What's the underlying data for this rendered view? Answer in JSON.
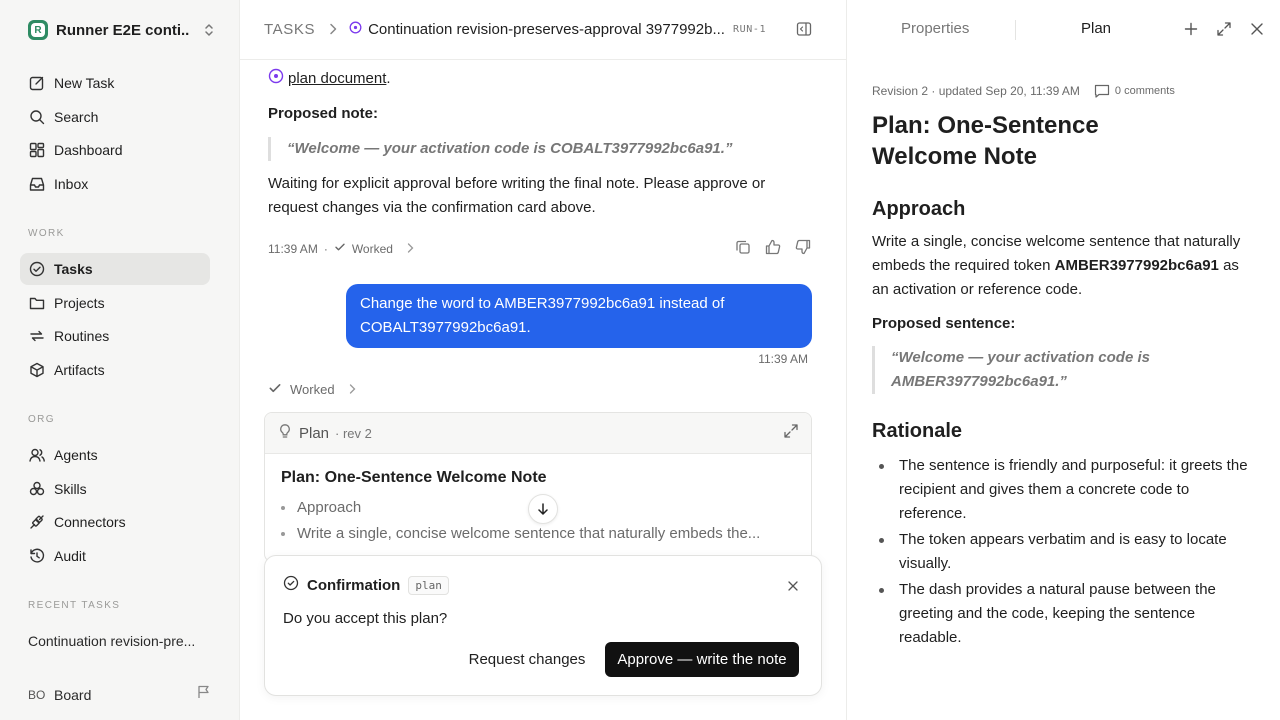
{
  "workspace": {
    "name": "Runner E2E conti...",
    "logo_letter": "R"
  },
  "sidebar": {
    "nav": [
      {
        "label": "New Task",
        "icon": "new-task-icon"
      },
      {
        "label": "Search",
        "icon": "search-icon"
      },
      {
        "label": "Dashboard",
        "icon": "dashboard-icon"
      },
      {
        "label": "Inbox",
        "icon": "inbox-icon"
      }
    ],
    "work_label": "WORK",
    "work": [
      {
        "label": "Tasks",
        "icon": "tasks-icon",
        "active": true
      },
      {
        "label": "Projects",
        "icon": "folder-icon"
      },
      {
        "label": "Routines",
        "icon": "routines-icon"
      },
      {
        "label": "Artifacts",
        "icon": "artifacts-icon"
      }
    ],
    "org_label": "ORG",
    "org": [
      {
        "label": "Agents",
        "icon": "agents-icon"
      },
      {
        "label": "Skills",
        "icon": "skills-icon"
      },
      {
        "label": "Connectors",
        "icon": "connectors-icon"
      },
      {
        "label": "Audit",
        "icon": "audit-icon"
      }
    ],
    "recent_label": "RECENT TASKS",
    "recent": [
      "Continuation revision-pre..."
    ],
    "user": {
      "initials": "BO",
      "name": "Board"
    }
  },
  "topbar": {
    "root": "TASKS",
    "title": "Continuation revision-preserves-approval 3977992b...",
    "run": "RUN-1"
  },
  "thread": {
    "plan_link": "plan document",
    "plan_link_suffix": ".",
    "proposed_note_label": "Proposed note:",
    "proposed_note": "“Welcome — your activation code is COBALT3977992bc6a91.”",
    "waiting_text": "Waiting for explicit approval before writing the final note. Please approve or request changes via the confirmation card above.",
    "meta_time": "11:39 AM",
    "meta_dot": "·",
    "meta_worked": "Worked",
    "user_message": "Change the word to AMBER3977992bc6a91 instead of COBALT3977992bc6a91.",
    "user_message_time": "11:39 AM",
    "worked2": "Worked"
  },
  "plan_card": {
    "label": "Plan",
    "rev": "· rev 2",
    "title": "Plan: One-Sentence Welcome Note",
    "items": [
      "Approach",
      "Write a single, concise welcome sentence that naturally embeds the..."
    ]
  },
  "confirmation": {
    "title": "Confirmation",
    "tag": "plan",
    "question": "Do you accept this plan?",
    "secondary": "Request changes",
    "primary": "Approve — write the note"
  },
  "right_panel": {
    "tabs": [
      "Properties",
      "Plan"
    ],
    "meta": "Revision 2 · updated Sep 20, 11:39 AM",
    "comments": "0 comments",
    "title": "Plan: One-Sentence Welcome Note",
    "approach_heading": "Approach",
    "approach_text_1": "Write a single, concise welcome sentence that naturally embeds the required token ",
    "approach_token": "AMBER3977992bc6a91",
    "approach_text_2": " as an activation or reference code.",
    "proposed_label": "Proposed sentence:",
    "proposed_quote": "“Welcome — your activation code is AMBER3977992bc6a91.”",
    "rationale_heading": "Rationale",
    "rationale": [
      "The sentence is friendly and purposeful: it greets the recipient and gives them a concrete code to reference.",
      "The token appears verbatim and is easy to locate visually.",
      "The dash provides a natural pause between the greeting and the code, keeping the sentence readable."
    ]
  },
  "colors": {
    "accent": "#2563eb",
    "brand": "#2e8b63",
    "primary_button": "#111111",
    "plan_icon": "#7c3aed"
  }
}
